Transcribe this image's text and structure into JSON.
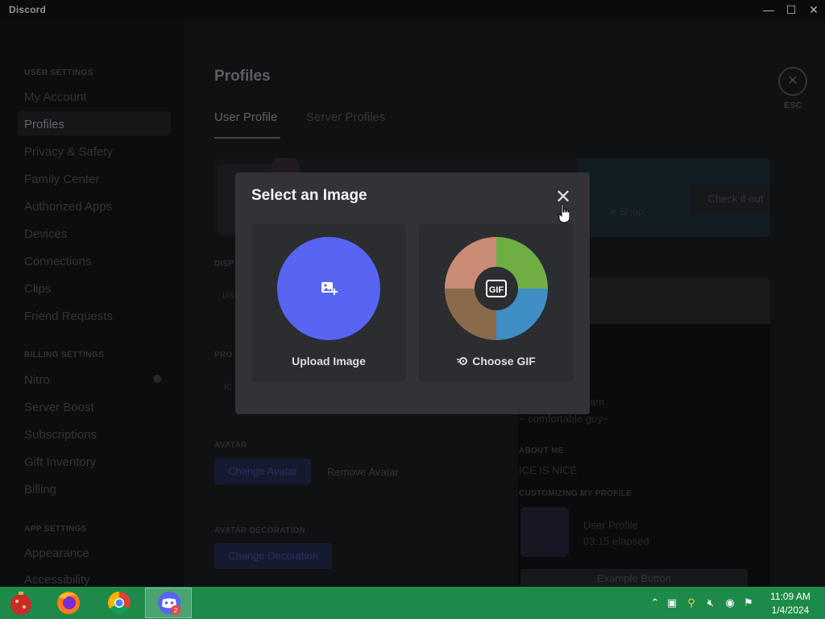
{
  "window": {
    "title": "Discord",
    "minimize": "—",
    "maximize": "☐",
    "close": "✕"
  },
  "sidebar": {
    "user_settings_head": "USER SETTINGS",
    "items_user": [
      "My Account",
      "Profiles",
      "Privacy & Safety",
      "Family Center",
      "Authorized Apps",
      "Devices",
      "Connections",
      "Clips",
      "Friend Requests"
    ],
    "billing_head": "BILLING SETTINGS",
    "items_billing": [
      "Nitro",
      "Server Boost",
      "Subscriptions",
      "Gift Inventory",
      "Billing"
    ],
    "app_head": "APP SETTINGS",
    "items_app": [
      "Appearance",
      "Accessibility"
    ]
  },
  "main": {
    "title": "Profiles",
    "tab_user": "User Profile",
    "tab_server": "Server Profiles",
    "esc_label": "ESC",
    "banner_text": "e Shop",
    "banner_button": "Check it out",
    "display_label": "DISP",
    "display_value": "us",
    "pronouns_label": "PRO",
    "pronouns_value": "ic",
    "avatar_label": "AVATAR",
    "change_avatar": "Change Avatar",
    "remove_avatar": "Remove Avatar",
    "decoration_label": "AVATAR DECORATION",
    "change_decoration": "Change Decoration"
  },
  "preview": {
    "name_fragment": "am",
    "status": "~ comfortable guy~",
    "about_head": "ABOUT ME",
    "about_text": "ICE IS NICE",
    "customizing_head": "CUSTOMIZING MY PROFILE",
    "activity_title": "User Profile",
    "activity_elapsed": "03:15 elapsed",
    "example_button": "Example Button"
  },
  "modal": {
    "title": "Select an Image",
    "close_glyph": "✕",
    "upload_label": "Upload Image",
    "gif_label": "Choose GIF",
    "gif_badge": "GIF"
  },
  "taskbar": {
    "notification_count": "2",
    "clock_time": "11:09 AM",
    "clock_date": "1/4/2024"
  },
  "colors": {
    "modal_bg": "#313338",
    "option_bg": "#2b2d31",
    "blurple": "#5865f2",
    "taskbar": "#1e8a4a"
  }
}
